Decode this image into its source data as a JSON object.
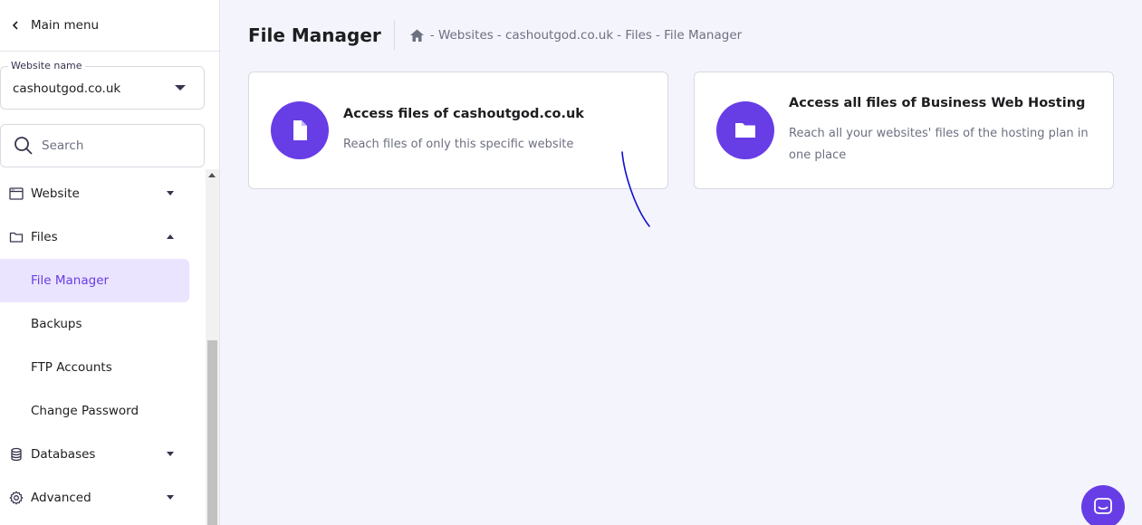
{
  "sidebar": {
    "main_menu_label": "Main menu",
    "website_select": {
      "legend": "Website name",
      "value": "cashoutgod.co.uk"
    },
    "search": {
      "placeholder": "Search"
    },
    "items": [
      {
        "label": "Website",
        "icon": "browser-window-icon",
        "expandable": true,
        "expanded": false
      },
      {
        "label": "Files",
        "icon": "folder-icon",
        "expandable": true,
        "expanded": true
      },
      {
        "label": "File Manager",
        "active": true
      },
      {
        "label": "Backups"
      },
      {
        "label": "FTP Accounts"
      },
      {
        "label": "Change Password"
      },
      {
        "label": "Databases",
        "icon": "database-icon",
        "expandable": true,
        "expanded": false
      },
      {
        "label": "Advanced",
        "icon": "gear-icon",
        "expandable": true,
        "expanded": false
      }
    ]
  },
  "header": {
    "title": "File Manager",
    "breadcrumb": [
      "- Websites",
      "- cashoutgod.co.uk",
      "- Files",
      "- File Manager"
    ]
  },
  "cards": [
    {
      "title": "Access files of cashoutgod.co.uk",
      "description": "Reach files of only this specific website",
      "icon": "file-icon"
    },
    {
      "title": "Access all files of Business Web Hosting",
      "description": "Reach all your websites' files of the hosting plan in one place",
      "icon": "folder-icon"
    }
  ],
  "colors": {
    "accent": "#673de6",
    "active_bg": "#ebe4ff",
    "page_bg": "#f4f4fc",
    "annotation_stroke": "#1010d0"
  }
}
